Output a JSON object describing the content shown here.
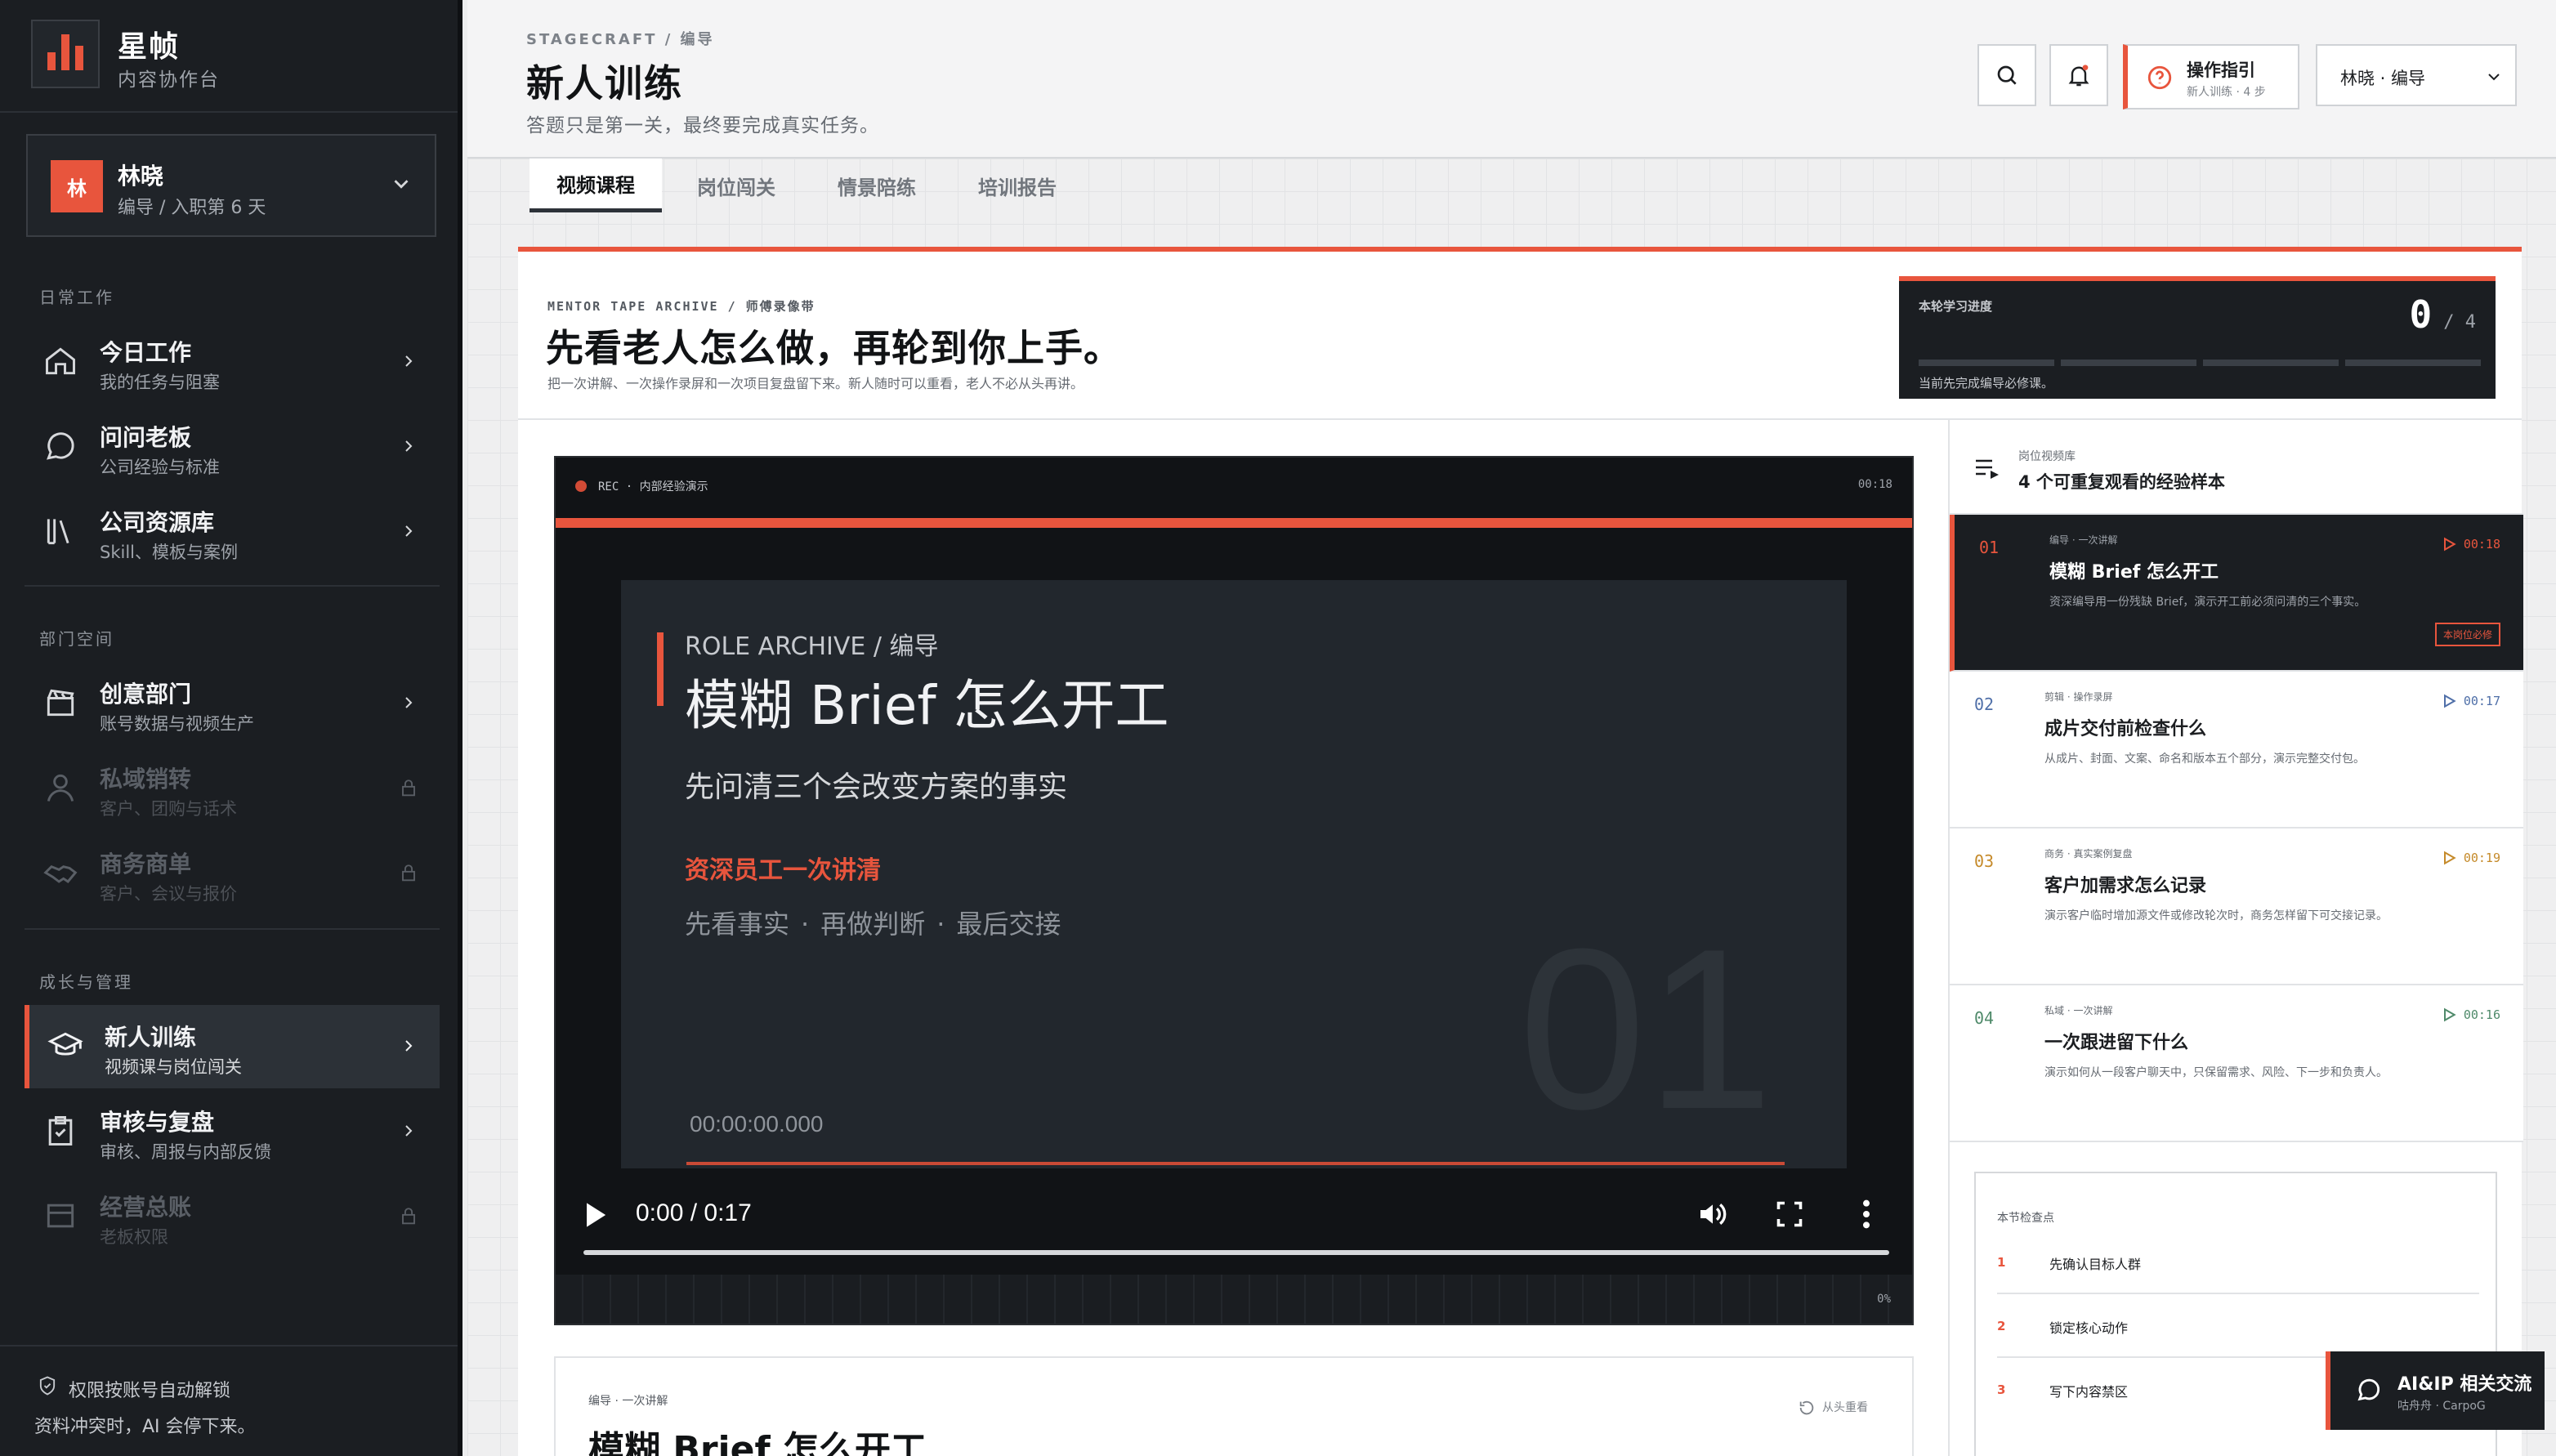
{
  "brand": {
    "name": "星帧",
    "subtitle": "内容协作台"
  },
  "user": {
    "avatar_char": "林",
    "name": "林晓",
    "role": "编导 / 入职第 6 天"
  },
  "nav": {
    "section_daily": "日常工作",
    "section_dept": "部门空间",
    "section_growth": "成长与管理",
    "items": [
      {
        "title": "今日工作",
        "desc": "我的任务与阻塞",
        "icon": "home-icon",
        "locked": false
      },
      {
        "title": "问问老板",
        "desc": "公司经验与标准",
        "icon": "chat-bubble-icon",
        "locked": false
      },
      {
        "title": "公司资源库",
        "desc": "Skill、模板与案例",
        "icon": "library-icon",
        "locked": false
      },
      {
        "title": "创意部门",
        "desc": "账号数据与视频生产",
        "icon": "clapperboard-icon",
        "locked": false
      },
      {
        "title": "私域销转",
        "desc": "客户、团购与话术",
        "icon": "user-icon",
        "locked": true
      },
      {
        "title": "商务商单",
        "desc": "客户、会议与报价",
        "icon": "handshake-icon",
        "locked": true
      },
      {
        "title": "新人训练",
        "desc": "视频课与岗位闯关",
        "icon": "graduation-cap-icon",
        "locked": false,
        "active": true
      },
      {
        "title": "审核与复盘",
        "desc": "审核、周报与内部反馈",
        "icon": "clipboard-icon",
        "locked": false
      },
      {
        "title": "经营总账",
        "desc": "老板权限",
        "icon": "ledger-icon",
        "locked": true
      }
    ]
  },
  "footer": {
    "line1": "权限按账号自动解锁",
    "line2": "资料冲突时，AI 会停下来。"
  },
  "header": {
    "breadcrumb": "STAGECRAFT  /  编导",
    "title": "新人训练",
    "subtitle": "答题只是第一关，最终要完成真实任务。",
    "guide_title": "操作指引",
    "guide_sub": "新人训练 · 4 步",
    "user_select": "林晓 · 编导"
  },
  "tabs": [
    "视频课程",
    "岗位闯关",
    "情景陪练",
    "培训报告"
  ],
  "archive": {
    "label": "MENTOR TAPE ARCHIVE  /  师傅录像带",
    "title": "先看老人怎么做，再轮到你上手。",
    "subtitle": "把一次讲解、一次操作录屏和一次项目复盘留下来。新人随时可以重看，老人不必从头再讲。"
  },
  "progress": {
    "label": "本轮学习进度",
    "done": "0",
    "total": "/ 4",
    "note": "当前先完成编导必修课。",
    "value": 0,
    "segments": 4
  },
  "player": {
    "rec": "REC",
    "rec_label": "内部经验演示",
    "duration_label": "00:18",
    "slide_label": "ROLE ARCHIVE / 编导",
    "slide_title": "模糊 Brief 怎么开工",
    "slide_sub": "先问清三个会改变方案的事实",
    "slide_highlight": "资深员工一次讲清",
    "slide_steps": [
      "先看事实",
      "·",
      "再做判断",
      "·",
      "最后交接"
    ],
    "slide_number": "01",
    "slide_timecode": "00:00:00.000",
    "time": "0:00 / 0:17",
    "film_pct": "0%"
  },
  "detail": {
    "tag": "编导  ·  一次讲解",
    "title": "模糊 Brief 怎么开工",
    "replay": "从头重看"
  },
  "library": {
    "label": "岗位视频库",
    "title": "4 个可重复观看的经验样本",
    "clips": [
      {
        "num": "01",
        "tag": "编导  ·  一次讲解",
        "title": "模糊 Brief 怎么开工",
        "desc": "资深编导用一份残缺 Brief，演示开工前必须问清的三个事实。",
        "dur": "00:18",
        "badge": "本岗位必修",
        "active": true
      },
      {
        "num": "02",
        "tag": "剪辑  ·  操作录屏",
        "title": "成片交付前检查什么",
        "desc": "从成片、封面、文案、命名和版本五个部分，演示完整交付包。",
        "dur": "00:17",
        "badge": "",
        "active": false
      },
      {
        "num": "03",
        "tag": "商务  ·  真实案例复盘",
        "title": "客户加需求怎么记录",
        "desc": "演示客户临时增加源文件或修改轮次时，商务怎样留下可交接记录。",
        "dur": "00:19",
        "badge": "",
        "active": false
      },
      {
        "num": "04",
        "tag": "私域  ·  一次讲解",
        "title": "一次跟进留下什么",
        "desc": "演示如何从一段客户聊天中，只保留需求、风险、下一步和负责人。",
        "dur": "00:16",
        "badge": "",
        "active": false
      }
    ]
  },
  "checkpoints": {
    "label": "本节检查点",
    "items": [
      {
        "n": "1",
        "t": "先确认目标人群"
      },
      {
        "n": "2",
        "t": "锁定核心动作"
      },
      {
        "n": "3",
        "t": "写下内容禁区"
      }
    ]
  },
  "chat": {
    "title": "AI&IP 相关交流",
    "sub": "咕舟舟 · CarpoG"
  },
  "colors": {
    "accent": "#e8553d",
    "sidebar": "#1b1e22",
    "play_blue": "#4f6fa8"
  }
}
